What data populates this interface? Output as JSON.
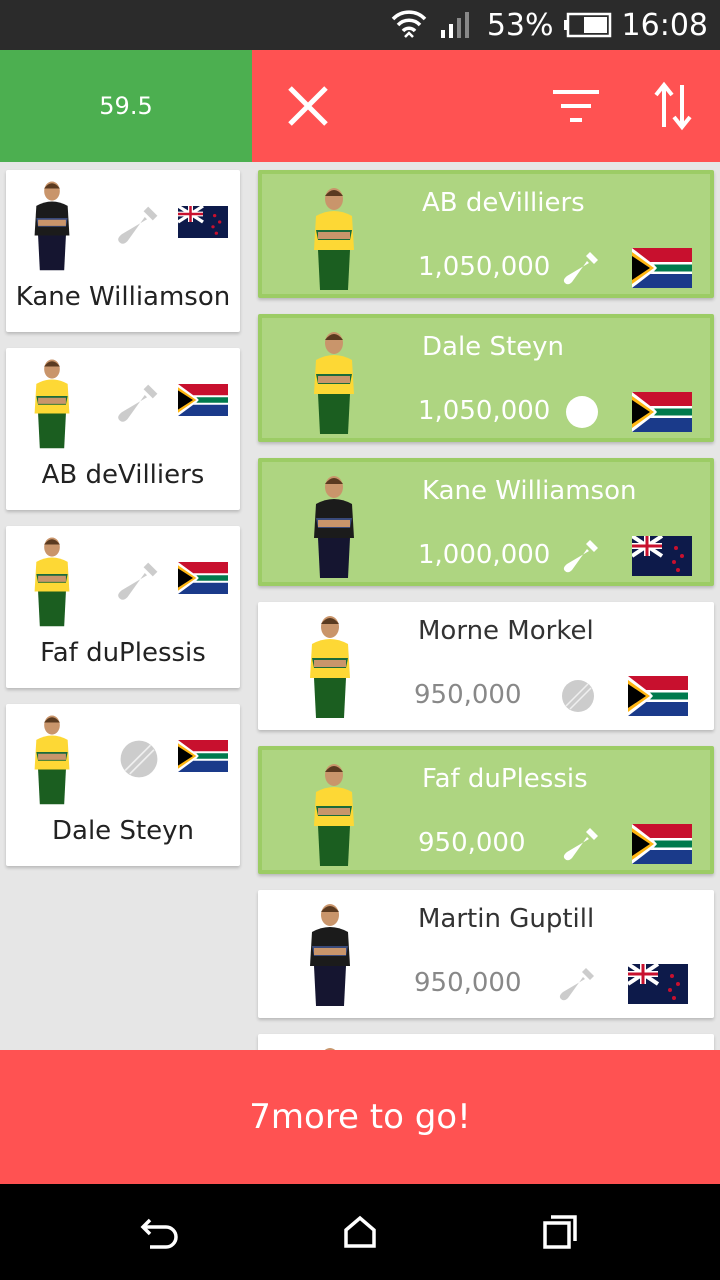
{
  "status": {
    "battery": "53%",
    "time": "16:08"
  },
  "budget": "59.5",
  "icons": {
    "close": "close-icon",
    "filter": "filter-icon",
    "sort": "sort-icon"
  },
  "colors": {
    "green": "#4caf50",
    "red": "#ff5252",
    "selected": "#aed581"
  },
  "team": [
    {
      "name": "Kane Williamson",
      "role": "bat",
      "country": "NZ"
    },
    {
      "name": "AB deVilliers",
      "role": "bat",
      "country": "SA"
    },
    {
      "name": "Faf duPlessis",
      "role": "bat",
      "country": "SA"
    },
    {
      "name": "Dale Steyn",
      "role": "ball",
      "country": "SA"
    }
  ],
  "players": [
    {
      "name": "AB deVilliers",
      "price": "1,050,000",
      "role": "bat",
      "country": "SA",
      "selected": true
    },
    {
      "name": "Dale Steyn",
      "price": "1,050,000",
      "role": "ball",
      "country": "SA",
      "selected": true
    },
    {
      "name": "Kane Williamson",
      "price": "1,000,000",
      "role": "bat",
      "country": "NZ",
      "selected": true
    },
    {
      "name": "Morne Morkel",
      "price": "950,000",
      "role": "ball",
      "country": "SA",
      "selected": false
    },
    {
      "name": "Faf duPlessis",
      "price": "950,000",
      "role": "bat",
      "country": "SA",
      "selected": true
    },
    {
      "name": "Martin Guptill",
      "price": "950,000",
      "role": "bat",
      "country": "NZ",
      "selected": false
    }
  ],
  "banner": "7more to go!"
}
